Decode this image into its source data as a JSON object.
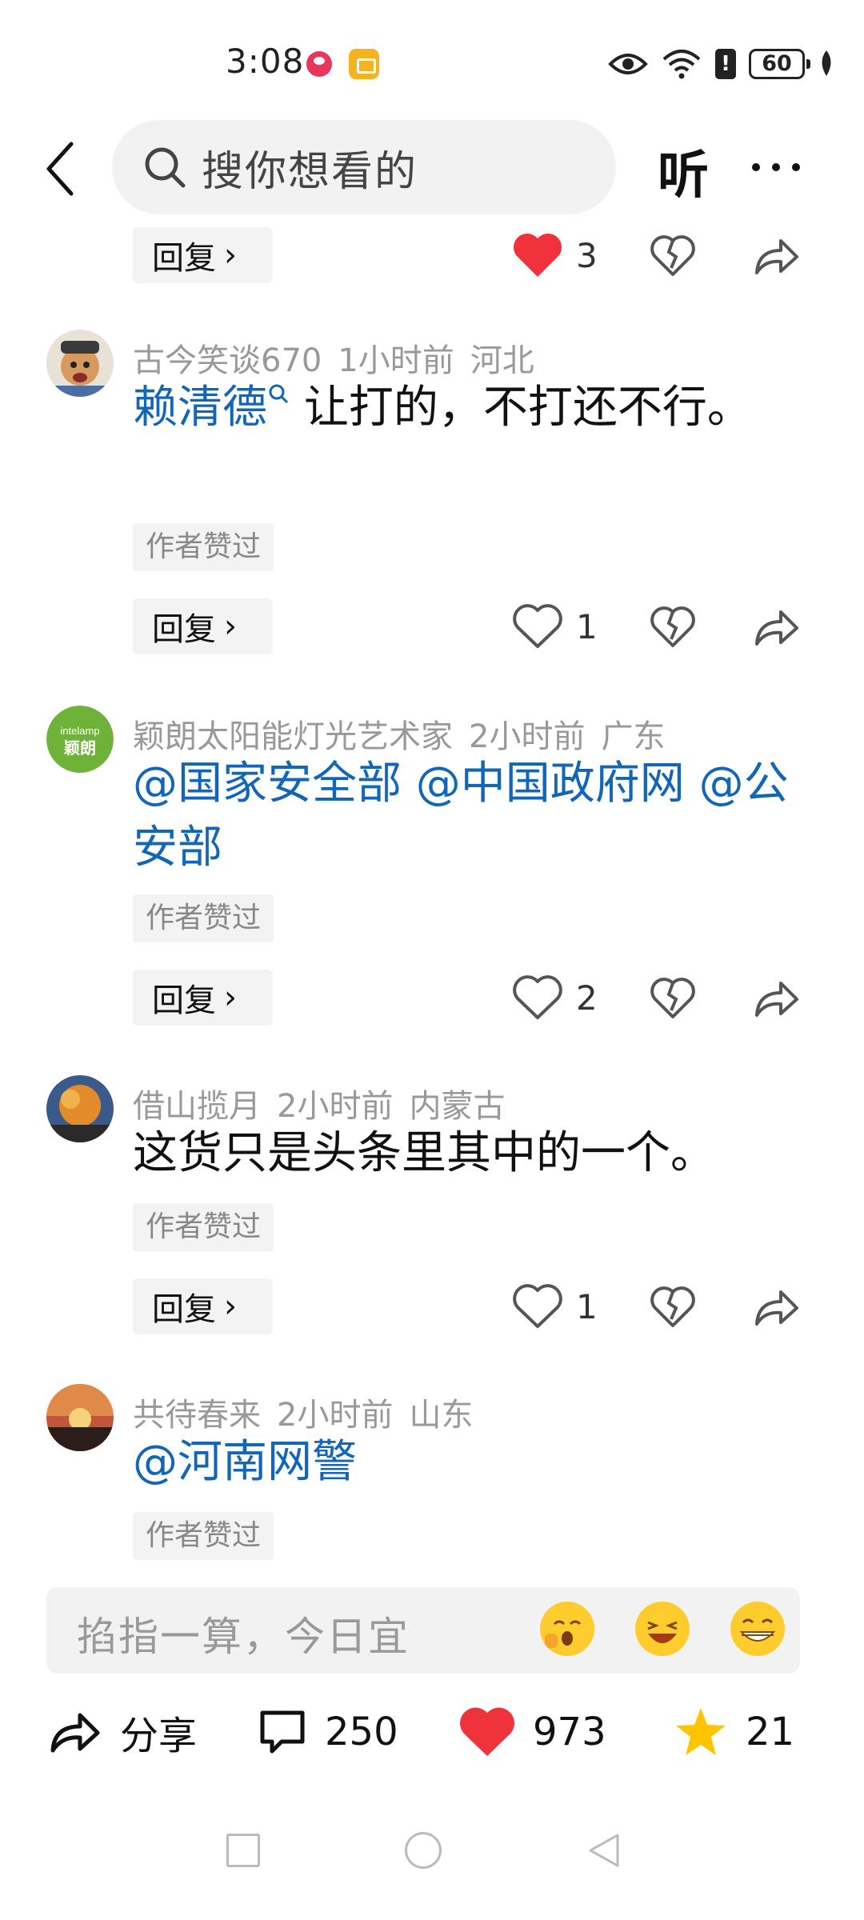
{
  "status_bar": {
    "time": "3:08",
    "battery": "60",
    "alert": "!"
  },
  "header": {
    "search_placeholder": "搜你想看的",
    "listen_label": "听"
  },
  "top_action_row": {
    "reply_label": "回复",
    "like_count": "3",
    "liked": true
  },
  "comments": [
    {
      "username": "古今笑谈670",
      "time": "1小时前",
      "location": "河北",
      "content_link": "赖清德",
      "content_text": "让打的，不打还不行。",
      "author_liked": "作者赞过",
      "reply_label": "回复",
      "like_count": "1"
    },
    {
      "username": "颖朗太阳能灯光艺术家",
      "time": "2小时前",
      "location": "广东",
      "avatar_text_top": "intelamp",
      "avatar_text_bottom": "颖朗",
      "content_link": "@国家安全部 @中国政府网 @公安部",
      "author_liked": "作者赞过",
      "reply_label": "回复",
      "like_count": "2"
    },
    {
      "username": "借山揽月",
      "time": "2小时前",
      "location": "内蒙古",
      "content_text": "这货只是头条里其中的一个。",
      "author_liked": "作者赞过",
      "reply_label": "回复",
      "like_count": "1"
    },
    {
      "username": "共待春来",
      "time": "2小时前",
      "location": "山东",
      "content_link": "@河南网警",
      "author_liked": "作者赞过"
    }
  ],
  "input_bar": {
    "placeholder": "掐指一算，今日宜"
  },
  "toolbar": {
    "share_label": "分享",
    "comment_count": "250",
    "like_count": "973",
    "favorite_count": "21"
  },
  "colors": {
    "link": "#1266b8",
    "like_red": "#f0323c",
    "star_yellow": "#ffc400"
  }
}
